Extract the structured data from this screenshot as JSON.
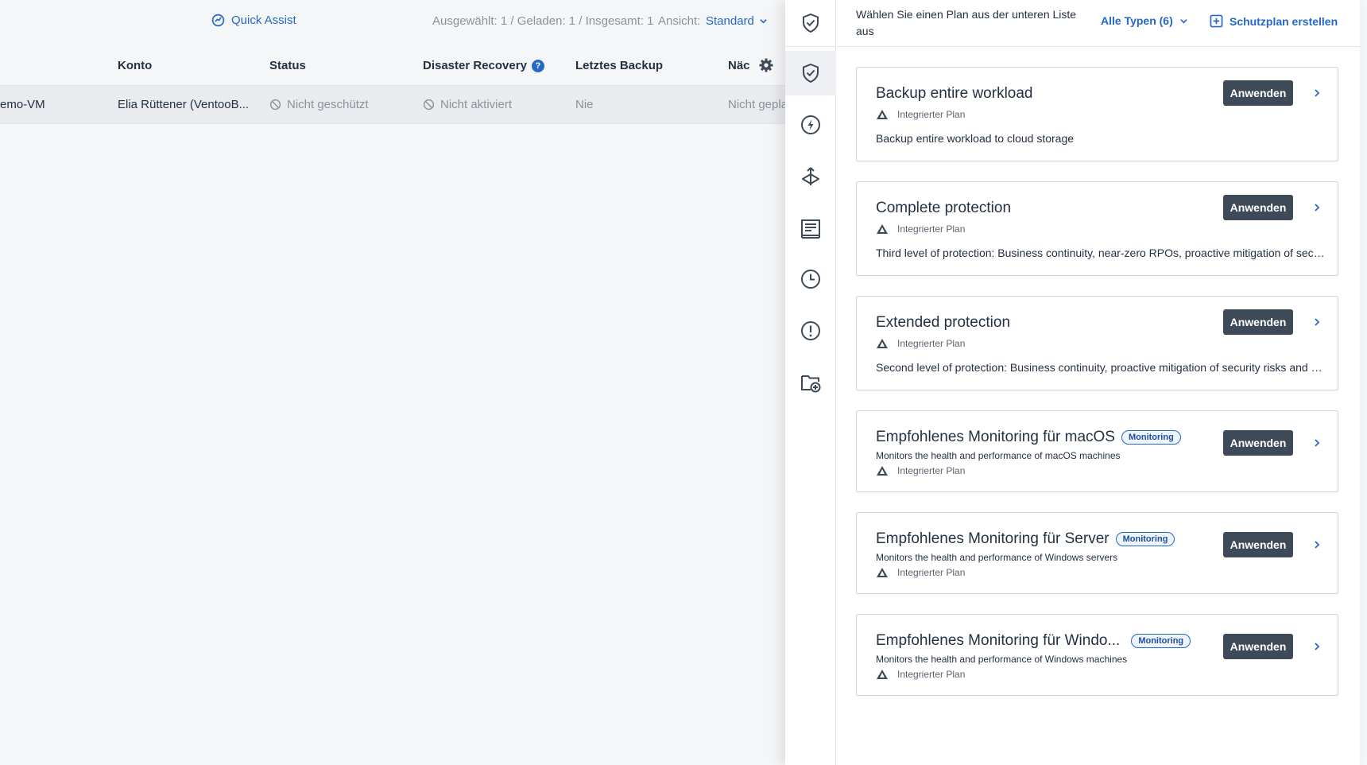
{
  "topbar": {
    "quick_assist": "Quick Assist",
    "counts": "Ausgewählt: 1 / Geladen: 1 / Insgesamt: 1",
    "view_label": "Ansicht:",
    "view_value": "Standard"
  },
  "table": {
    "columns": [
      "Konto",
      "Status",
      "Disaster Recovery",
      "Letztes Backup",
      "Näc"
    ],
    "row": {
      "name": "emo-VM",
      "account": "Elia Rüttener (VentooB...",
      "status": "Nicht geschützt",
      "dr": "Nicht aktiviert",
      "last_backup": "Nie",
      "next": "Nicht gepla"
    }
  },
  "drawer": {
    "hint": "Wählen Sie einen Plan aus der unteren Liste aus",
    "types_filter": "Alle Typen (6)",
    "create_plan": "Schutzplan erstellen",
    "rail_icons": [
      "shield-check-icon",
      "lightning-icon",
      "replicate-icon",
      "report-icon",
      "clock-icon",
      "alert-icon",
      "folder-add-icon"
    ],
    "plans": [
      {
        "title": "Backup entire workload",
        "badge": "",
        "subtitle": "",
        "meta": "Integrierter Plan",
        "description": "Backup entire workload to cloud storage",
        "apply": "Anwenden"
      },
      {
        "title": "Complete protection",
        "badge": "",
        "subtitle": "",
        "meta": "Integrierter Plan",
        "description": "Third level of protection: Business continuity, near-zero RPOs, proactive mitigation of security risks, application-aware backups",
        "apply": "Anwenden"
      },
      {
        "title": "Extended protection",
        "badge": "",
        "subtitle": "",
        "meta": "Integrierter Plan",
        "description": "Second level of protection: Business continuity, proactive mitigation of security risks and vulnerability assessment",
        "apply": "Anwenden"
      },
      {
        "title": "Empfohlenes Monitoring für macOS",
        "badge": "Monitoring",
        "subtitle": "Monitors the health and performance of macOS machines",
        "meta": "Integrierter Plan",
        "description": "",
        "apply": "Anwenden"
      },
      {
        "title": "Empfohlenes Monitoring für Server",
        "badge": "Monitoring",
        "subtitle": "Monitors the health and performance of Windows servers",
        "meta": "Integrierter Plan",
        "description": "",
        "apply": "Anwenden"
      },
      {
        "title": "Empfohlenes Monitoring für Windo...",
        "badge": "Monitoring",
        "subtitle": "Monitors the health and performance of Windows machines",
        "meta": "Integrierter Plan",
        "description": "",
        "apply": "Anwenden"
      }
    ]
  },
  "colors": {
    "accent": "#2668c5",
    "button": "#3f4a58",
    "text": "#243143",
    "muted": "#8b929c"
  }
}
